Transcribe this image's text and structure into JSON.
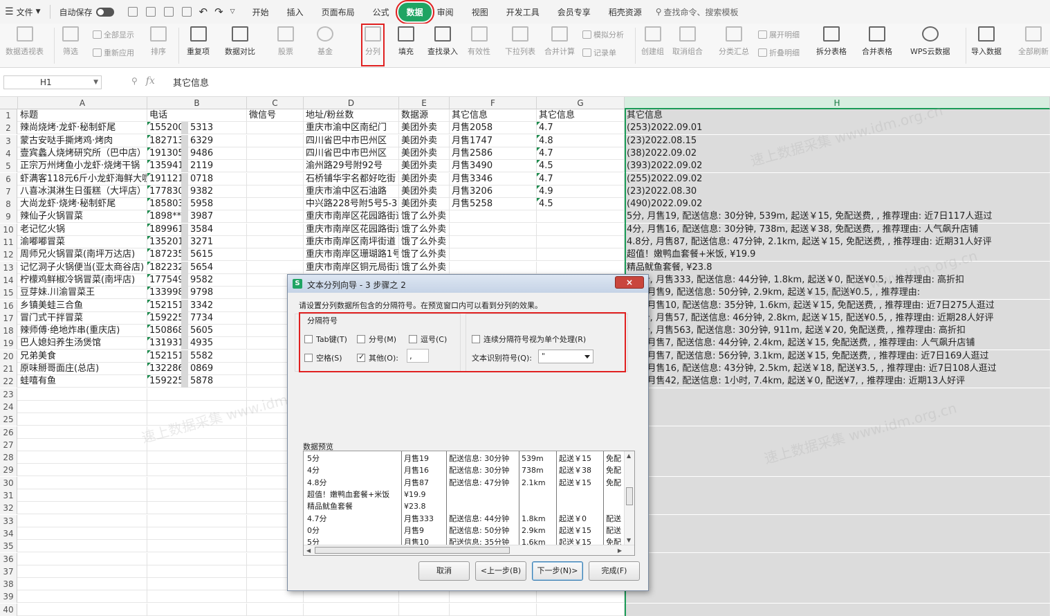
{
  "menubar": {
    "file": "文件",
    "autosave": "自动保存",
    "tabs": [
      "开始",
      "插入",
      "页面布局",
      "公式",
      "数据",
      "审阅",
      "视图",
      "开发工具",
      "会员专享",
      "稻壳资源"
    ],
    "active_tab": "数据",
    "search_placeholder": "查找命令、搜索模板"
  },
  "ribbon": {
    "pivot": "数据透视表",
    "filter": "筛选",
    "show_all": "全部显示",
    "reapply": "重新应用",
    "sort": "排序",
    "duplicates": "重复项",
    "compare": "数据对比",
    "stock": "股票",
    "fund": "基金",
    "split": "分列",
    "fill": "填充",
    "lookup_entry": "查找录入",
    "validity": "有效性",
    "dropdown_list": "下拉列表",
    "consolidate": "合并计算",
    "what_if": "模拟分析",
    "record_form": "记录单",
    "create_group": "创建组",
    "ungroup": "取消组合",
    "subtotal": "分类汇总",
    "expand_detail": "展开明细",
    "collapse_detail": "折叠明细",
    "split_table": "拆分表格",
    "merge_table": "合并表格",
    "wps_cloud": "WPS云数据",
    "import_data": "导入数据",
    "refresh_all": "全部刷新"
  },
  "formula_bar": {
    "cell_ref": "H1",
    "fx": "fx",
    "content": "其它信息"
  },
  "columns": [
    "A",
    "B",
    "C",
    "D",
    "E",
    "F",
    "G",
    "H"
  ],
  "row_numbers": [
    "1",
    "2",
    "3",
    "4",
    "5",
    "6",
    "7",
    "8",
    "9",
    "10",
    "11",
    "12",
    "13",
    "14",
    "15",
    "16",
    "17",
    "18",
    "19",
    "20",
    "21",
    "22",
    "23",
    "24",
    "25",
    "26",
    "27",
    "28",
    "29",
    "30",
    "31",
    "32",
    "33",
    "34",
    "35",
    "36",
    "37",
    "38",
    "39",
    "40"
  ],
  "rows": [
    [
      "标题",
      "电话",
      "微信号",
      "地址/粉丝数",
      "数据源",
      "其它信息",
      "其它信息",
      "其它信息"
    ],
    [
      "辣尚烧烤·龙虾·秘制虾尾",
      "155200",
      "",
      "重庆市渝中区南纪门",
      "美团外卖",
      "月售2058",
      "4.7",
      "(253)2022.09.01"
    ],
    [
      "蒙古安哒手撕烤鸡·烤肉",
      "182713",
      "",
      "四川省巴中市巴州区",
      "美团外卖",
      "月售1747",
      "4.8",
      "(23)2022.08.15"
    ],
    [
      "壹宾蠡人烧烤研究所（巴中店）",
      "191305",
      "",
      "四川省巴中市巴州区",
      "美团外卖",
      "月售2586",
      "4.7",
      "(38)2022.09.02"
    ],
    [
      "正宗万州烤鱼小龙虾·烧烤干锅",
      "135941",
      "",
      "渝州路29号附92号",
      "美团外卖",
      "月售3490",
      "4.5",
      "(393)2022.09.02"
    ],
    [
      "虾满客118元6斤小龙虾海鲜大咖",
      "191121",
      "",
      "石桥铺华宇名都好吃街",
      "美团外卖",
      "月售3346",
      "4.7",
      "(255)2022.09.02"
    ],
    [
      "八喜冰淇淋生日蛋糕（大坪店）",
      "177830",
      "",
      "重庆市渝中区石油路",
      "美团外卖",
      "月售3206",
      "4.9",
      "(23)2022.08.30"
    ],
    [
      "大尚龙虾·烧烤·秘制虾尾",
      "185803",
      "",
      "中兴路228号附5号5-3",
      "美团外卖",
      "月售5258",
      "4.5",
      "(490)2022.09.02"
    ],
    [
      "辣仙子火锅冒菜",
      "1898**",
      "",
      "重庆市南岸区花园路街道",
      "饿了么外卖",
      "",
      "",
      "5分, 月售19, 配送信息: 30分钟, 539m, 起送￥15, 免配送费, , 推荐理由: 近7日117人逛过"
    ],
    [
      "老记忆火锅",
      "189961",
      "",
      "重庆市南岸区花园路街道",
      "饿了么外卖",
      "",
      "",
      "4分, 月售16, 配送信息: 30分钟, 738m, 起送￥38, 免配送费, , 推荐理由: 人气飙升店铺"
    ],
    [
      "渝嘟嘟冒菜",
      "135201",
      "",
      "重庆市南岸区南坪街道",
      "饿了么外卖",
      "",
      "",
      "4.8分, 月售87, 配送信息: 47分钟, 2.1km, 起送￥15, 免配送费, , 推荐理由: 近期31人好评"
    ],
    [
      "周师兄火锅冒菜(南坪万达店)",
      "187235",
      "",
      "重庆市南岸区珊瑚路1号",
      "饿了么外卖",
      "",
      "",
      "超值！嫩鸭血套餐+米饭, ¥19.9"
    ],
    [
      "记忆洞子火锅便当(亚太商谷店)",
      "182232",
      "",
      "重庆市南岸区铜元局街道",
      "饿了么外卖",
      "",
      "",
      "精品鱿鱼套餐, ¥23.8"
    ],
    [
      "柠檬鸡鲜椒冷锅冒菜(南坪店)",
      "177549",
      "",
      "",
      "",
      "",
      "",
      "4.7分, 月售333, 配送信息: 44分钟, 1.8km, 起送￥0, 配送¥0.5, , 推荐理由: 高折扣"
    ],
    [
      "豆芽妹.川渝冒菜王",
      "133998",
      "",
      "",
      "",
      "",
      "",
      "0分, 月售9, 配送信息: 50分钟, 2.9km, 起送￥15, 配送¥0.5, , 推荐理由:"
    ],
    [
      "乡镇美蛙三合鱼",
      "152151",
      "",
      "",
      "",
      "",
      "",
      "5分, 月售10, 配送信息: 35分钟, 1.6km, 起送￥15, 免配送费, , 推荐理由: 近7日275人逛过"
    ],
    [
      "冒门式干拌冒菜",
      "159225",
      "",
      "",
      "",
      "",
      "",
      "4.6分, 月售57, 配送信息: 46分钟, 2.8km, 起送￥15, 配送¥0.5, , 推荐理由: 近期28人好评"
    ],
    [
      "辣师傅·绝地炸串(重庆店)",
      "150868",
      "",
      "",
      "",
      "",
      "",
      "4.6分, 月售563, 配送信息: 30分钟, 911m, 起送￥20, 免配送费, , 推荐理由: 高折扣"
    ],
    [
      "巴人媳妇养生汤煲馆",
      "131931",
      "",
      "",
      "",
      "",
      "",
      "5分, 月售7, 配送信息: 44分钟, 2.4km, 起送￥15, 免配送费, , 推荐理由: 人气飙升店铺"
    ],
    [
      "兄弟美食",
      "152151",
      "",
      "",
      "",
      "",
      "",
      "5分, 月售7, 配送信息: 56分钟, 3.1km, 起送￥15, 免配送费, , 推荐理由: 近7日169人逛过"
    ],
    [
      "原味掰哥面庄(总店)",
      "132286",
      "",
      "",
      "",
      "",
      "",
      "5分, 月售16, 配送信息: 43分钟, 2.5km, 起送￥18, 配送¥3.5, , 推荐理由: 近7日108人逛过"
    ],
    [
      "蛙嘻有鱼",
      "159225",
      "",
      "",
      "",
      "",
      "",
      "5分, 月售42, 配送信息: 1小时, 7.4km, 起送￥0, 配送¥7, , 推荐理由: 近期13人好评"
    ]
  ],
  "phone_tails": [
    "",
    "5313",
    "6329",
    "9486",
    "2119",
    "0718",
    "9382",
    "5958",
    "3987",
    "3584",
    "3271",
    "5615",
    "5654",
    "9582",
    "9798",
    "3342",
    "7734",
    "5605",
    "4935",
    "5582",
    "0869",
    "5878"
  ],
  "watermark": "速上数据采集 www.idm.org.cn",
  "dialog": {
    "title": "文本分列向导 - 3 步骤之 2",
    "close": "×",
    "instruction": "请设置分列数据所包含的分隔符号。在预览窗口内可以看到分列的效果。",
    "group_label": "分隔符号",
    "tab": "Tab键(T)",
    "semicolon": "分号(M)",
    "comma": "逗号(C)",
    "space": "空格(S)",
    "other": "其他(O):",
    "other_value": ",",
    "consecutive": "连续分隔符号视为单个处理(R)",
    "qualifier_label": "文本识别符号(Q):",
    "qualifier_value": "\"",
    "preview_label": "数据预览",
    "cancel": "取消",
    "back": "<上一步(B)",
    "next": "下一步(N)>",
    "finish": "完成(F)"
  },
  "preview": [
    [
      "5分",
      "月售19",
      "配送信息: 30分钟",
      "539m",
      "起送￥15",
      "免配"
    ],
    [
      "4分",
      "月售16",
      "配送信息: 30分钟",
      "738m",
      "起送￥38",
      "免配"
    ],
    [
      "4.8分",
      "月售87",
      "配送信息: 47分钟",
      "2.1km",
      "起送￥15",
      "免配"
    ],
    [
      "超值！嫩鸭血套餐+米饭",
      "¥19.9",
      "",
      "",
      "",
      ""
    ],
    [
      "精品鱿鱼套餐",
      "¥23.8",
      "",
      "",
      "",
      ""
    ],
    [
      "4.7分",
      "月售333",
      "配送信息: 44分钟",
      "1.8km",
      "起送￥0",
      "配送"
    ],
    [
      "0分",
      "月售9",
      "配送信息: 50分钟",
      "2.9km",
      "起送￥15",
      "配送"
    ],
    [
      "5分",
      "月售10",
      "配送信息: 35分钟",
      "1.6km",
      "起送￥15",
      "免配"
    ]
  ]
}
